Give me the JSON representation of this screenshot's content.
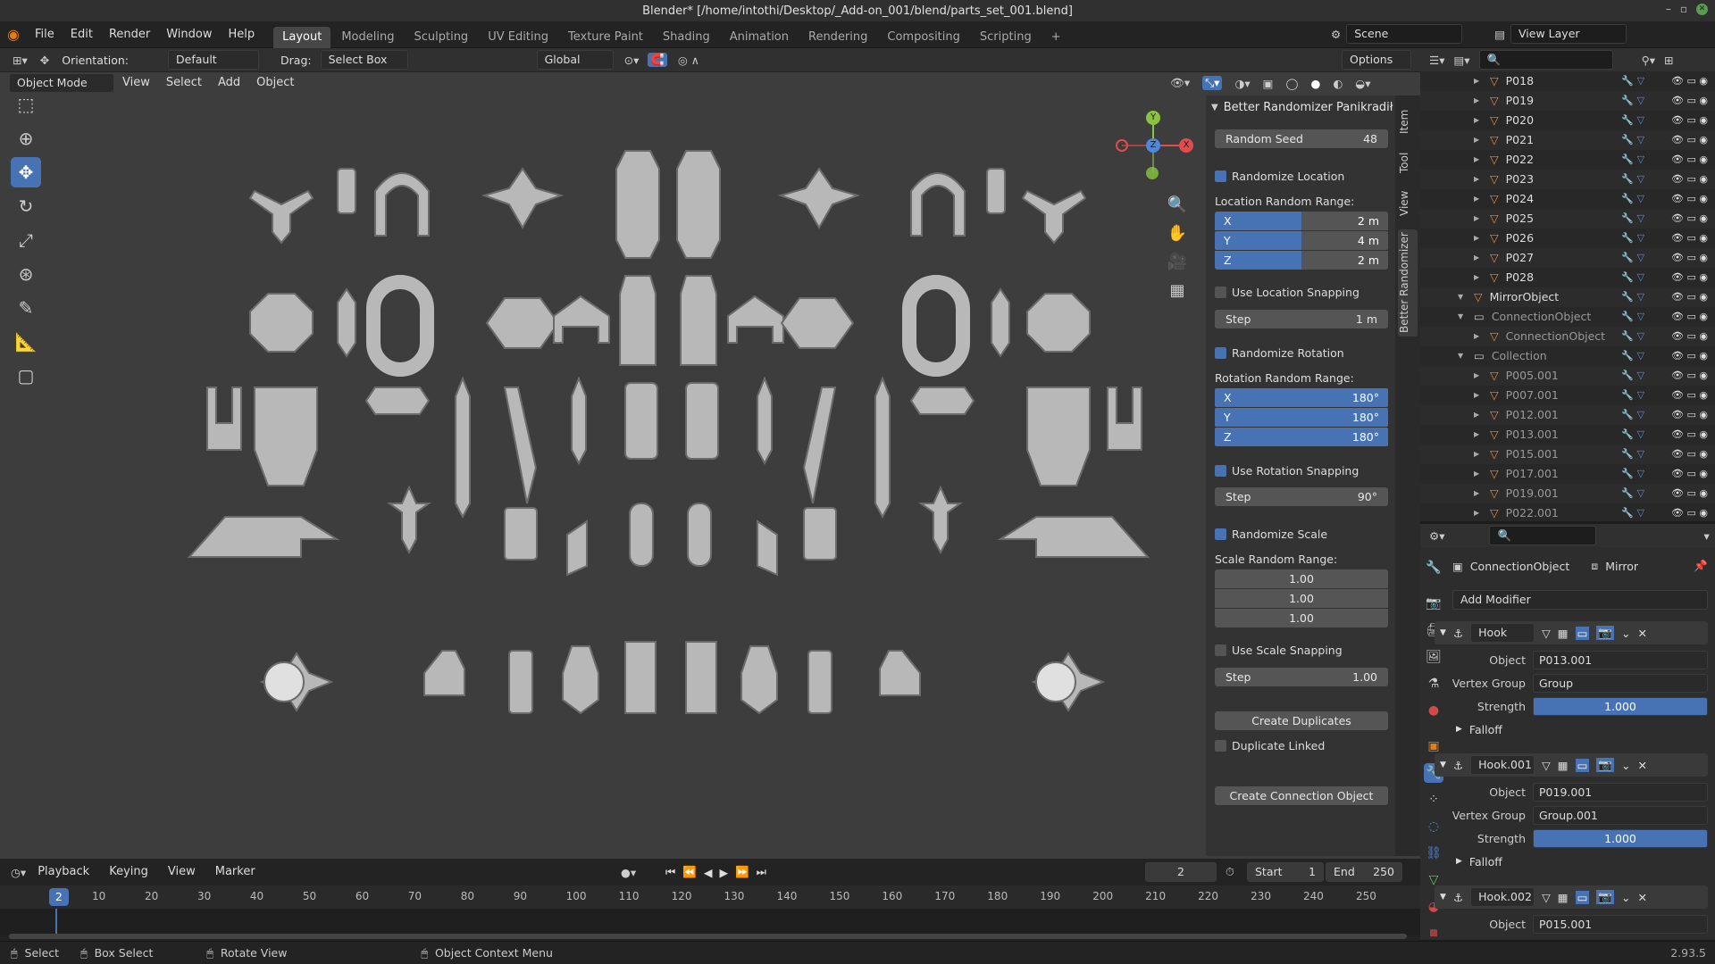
{
  "titlebar": {
    "title": "Blender* [/home/intothi/Desktop/_Add-on_001/blend/parts_set_001.blend]"
  },
  "menu": {
    "file": "File",
    "edit": "Edit",
    "render": "Render",
    "window": "Window",
    "help": "Help"
  },
  "workspaces": [
    "Layout",
    "Modeling",
    "Sculpting",
    "UV Editing",
    "Texture Paint",
    "Shading",
    "Animation",
    "Rendering",
    "Compositing",
    "Scripting"
  ],
  "scene": {
    "label": "Scene",
    "view_layer": "View Layer"
  },
  "tool_header": {
    "orientation_label": "Orientation:",
    "orientation_value": "Default",
    "drag_label": "Drag:",
    "drag_value": "Select Box",
    "transform_space": "Global",
    "options": "Options"
  },
  "view_header": {
    "mode": "Object Mode",
    "view": "View",
    "select": "Select",
    "add": "Add",
    "object": "Object"
  },
  "gizmo": {
    "x": "X",
    "y": "Y",
    "z": "Z"
  },
  "npanel": {
    "title": "Better Randomizer Panikradił",
    "random_seed_label": "Random Seed",
    "random_seed_value": "48",
    "randomize_location": "Randomize Location",
    "location_range_label": "Location Random Range:",
    "location": [
      {
        "axis": "X",
        "value": "2 m",
        "fill": 0.5
      },
      {
        "axis": "Y",
        "value": "4 m",
        "fill": 0.5
      },
      {
        "axis": "Z",
        "value": "2 m",
        "fill": 0.5
      }
    ],
    "use_location_snapping": "Use Location Snapping",
    "loc_step_label": "Step",
    "loc_step_value": "1 m",
    "randomize_rotation": "Randomize Rotation",
    "rotation_range_label": "Rotation Random Range:",
    "rotation": [
      {
        "axis": "X",
        "value": "180°"
      },
      {
        "axis": "Y",
        "value": "180°"
      },
      {
        "axis": "Z",
        "value": "180°"
      }
    ],
    "use_rotation_snapping": "Use Rotation Snapping",
    "rot_step_label": "Step",
    "rot_step_value": "90°",
    "randomize_scale": "Randomize Scale",
    "scale_range_label": "Scale Random Range:",
    "scale": [
      "1.00",
      "1.00",
      "1.00"
    ],
    "use_scale_snapping": "Use Scale Snapping",
    "scale_step_label": "Step",
    "scale_step_value": "1.00",
    "create_duplicates": "Create Duplicates",
    "duplicate_linked": "Duplicate Linked",
    "create_connection_object": "Create Connection Object"
  },
  "vtabs": {
    "item": "Item",
    "tool": "Tool",
    "view": "View",
    "better": "Better Randomizer"
  },
  "outliner": {
    "rows": [
      {
        "name": "P018",
        "indent": 3
      },
      {
        "name": "P019",
        "indent": 3
      },
      {
        "name": "P020",
        "indent": 3
      },
      {
        "name": "P021",
        "indent": 3
      },
      {
        "name": "P022",
        "indent": 3
      },
      {
        "name": "P023",
        "indent": 3
      },
      {
        "name": "P024",
        "indent": 3
      },
      {
        "name": "P025",
        "indent": 3
      },
      {
        "name": "P026",
        "indent": 3
      },
      {
        "name": "P027",
        "indent": 3
      },
      {
        "name": "P028",
        "indent": 3
      },
      {
        "name": "MirrorObject",
        "indent": 2
      },
      {
        "name": "ConnectionObject",
        "indent": 2
      },
      {
        "name": "ConnectionObject",
        "indent": 3
      },
      {
        "name": "Collection",
        "indent": 2
      },
      {
        "name": "P005.001",
        "indent": 3
      },
      {
        "name": "P007.001",
        "indent": 3
      },
      {
        "name": "P012.001",
        "indent": 3
      },
      {
        "name": "P013.001",
        "indent": 3
      },
      {
        "name": "P015.001",
        "indent": 3
      },
      {
        "name": "P017.001",
        "indent": 3
      },
      {
        "name": "P019.001",
        "indent": 3
      },
      {
        "name": "P022.001",
        "indent": 3
      }
    ]
  },
  "properties": {
    "object_name": "ConnectionObject",
    "modifier_name": "Mirror",
    "add_modifier": "Add Modifier",
    "modifiers": [
      {
        "name": "Hook",
        "object": "P013.001",
        "vertex_group": "Group",
        "strength": "1.000",
        "falloff": "Falloff"
      },
      {
        "name": "Hook.001",
        "object": "P019.001",
        "vertex_group": "Group.001",
        "strength": "1.000",
        "falloff": "Falloff"
      },
      {
        "name": "Hook.002",
        "object": "P015.001"
      }
    ],
    "object_label": "Object",
    "vg_label": "Vertex Group",
    "strength_label": "Strength"
  },
  "timeline": {
    "playback": "Playback",
    "keying": "Keying",
    "view": "View",
    "marker": "Marker",
    "current": "2",
    "start_label": "Start",
    "start": "1",
    "end_label": "End",
    "end": "250",
    "ticks": [
      "10",
      "20",
      "30",
      "40",
      "50",
      "60",
      "70",
      "80",
      "90",
      "100",
      "110",
      "120",
      "130",
      "140",
      "150",
      "160",
      "170",
      "180",
      "190",
      "200",
      "210",
      "220",
      "230",
      "240",
      "250"
    ],
    "playhead": "2"
  },
  "status": {
    "select": "Select",
    "box_select": "Box Select",
    "rotate_view": "Rotate View",
    "context_menu": "Object Context Menu",
    "version": "2.93.5"
  }
}
